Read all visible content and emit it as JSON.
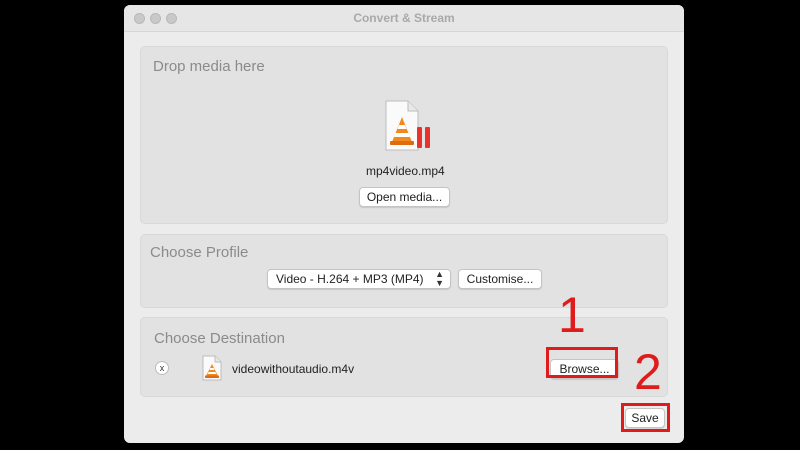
{
  "window": {
    "title": "Convert & Stream"
  },
  "drop_media": {
    "title": "Drop media here",
    "file_name": "mp4video.mp4",
    "open_button": "Open media..."
  },
  "profile": {
    "title": "Choose Profile",
    "selected": "Video - H.264 + MP3 (MP4)",
    "customise_button": "Customise..."
  },
  "destination": {
    "title": "Choose Destination",
    "remove_label": "x",
    "file_name": "videowithoutaudio.m4v",
    "browse_button": "Browse..."
  },
  "save_button": "Save",
  "annotations": {
    "step1": "1",
    "step2": "2",
    "color": "#e01b1b"
  },
  "icons": {
    "media_file": "vlc-cone-file-icon",
    "destination_file": "vlc-cone-file-icon",
    "select_chevron": "up-down-chevron-icon"
  }
}
